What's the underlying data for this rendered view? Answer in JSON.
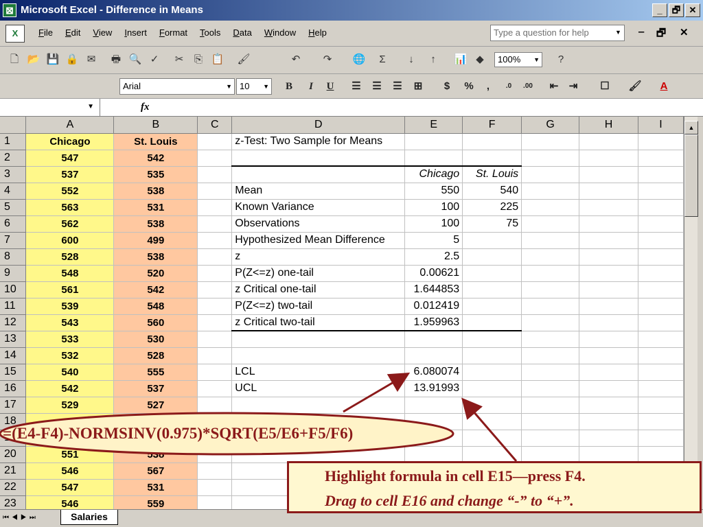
{
  "window": {
    "title": "Microsoft Excel - Difference in Means",
    "min": "_",
    "max": "🗗",
    "close": "✕"
  },
  "menu": {
    "items": [
      "File",
      "Edit",
      "View",
      "Insert",
      "Format",
      "Tools",
      "Data",
      "Window",
      "Help"
    ],
    "help_placeholder": "Type a question for help"
  },
  "toolbar": {
    "zoom": "100%",
    "font": "Arial",
    "font_size": "10"
  },
  "formula_bar": {
    "fx": "fx",
    "name_box": ""
  },
  "columns": [
    "A",
    "B",
    "C",
    "D",
    "E",
    "F",
    "G",
    "H",
    "I"
  ],
  "sheet": {
    "rows": [
      {
        "n": "1",
        "a": "Chicago",
        "b": "St. Louis",
        "d": "z-Test: Two Sample for Means",
        "e": "",
        "f": ""
      },
      {
        "n": "2",
        "a": "547",
        "b": "542",
        "d": "",
        "e": "",
        "f": ""
      },
      {
        "n": "3",
        "a": "537",
        "b": "535",
        "d": "",
        "e": "Chicago",
        "f": "St. Louis"
      },
      {
        "n": "4",
        "a": "552",
        "b": "538",
        "d": "Mean",
        "e": "550",
        "f": "540"
      },
      {
        "n": "5",
        "a": "563",
        "b": "531",
        "d": "Known Variance",
        "e": "100",
        "f": "225"
      },
      {
        "n": "6",
        "a": "562",
        "b": "538",
        "d": "Observations",
        "e": "100",
        "f": "75"
      },
      {
        "n": "7",
        "a": "600",
        "b": "499",
        "d": "Hypothesized Mean Difference",
        "e": "5",
        "f": ""
      },
      {
        "n": "8",
        "a": "528",
        "b": "538",
        "d": "z",
        "e": "2.5",
        "f": ""
      },
      {
        "n": "9",
        "a": "548",
        "b": "520",
        "d": "P(Z<=z) one-tail",
        "e": "0.00621",
        "f": ""
      },
      {
        "n": "10",
        "a": "561",
        "b": "542",
        "d": "z Critical one-tail",
        "e": "1.644853",
        "f": ""
      },
      {
        "n": "11",
        "a": "539",
        "b": "548",
        "d": "P(Z<=z) two-tail",
        "e": "0.012419",
        "f": ""
      },
      {
        "n": "12",
        "a": "543",
        "b": "560",
        "d": "z Critical two-tail",
        "e": "1.959963",
        "f": ""
      },
      {
        "n": "13",
        "a": "533",
        "b": "530",
        "d": "",
        "e": "",
        "f": ""
      },
      {
        "n": "14",
        "a": "532",
        "b": "528",
        "d": "",
        "e": "",
        "f": ""
      },
      {
        "n": "15",
        "a": "540",
        "b": "555",
        "d": "LCL",
        "e": "6.080074",
        "f": ""
      },
      {
        "n": "16",
        "a": "542",
        "b": "537",
        "d": "UCL",
        "e": "13.91993",
        "f": ""
      },
      {
        "n": "17",
        "a": "529",
        "b": "527",
        "d": "",
        "e": "",
        "f": ""
      },
      {
        "n": "18",
        "a": "",
        "b": "",
        "d": "",
        "e": "",
        "f": ""
      },
      {
        "n": "19",
        "a": "",
        "b": "",
        "d": "",
        "e": "",
        "f": ""
      },
      {
        "n": "20",
        "a": "551",
        "b": "538",
        "d": "",
        "e": "",
        "f": ""
      },
      {
        "n": "21",
        "a": "546",
        "b": "567",
        "d": "",
        "e": "",
        "f": ""
      },
      {
        "n": "22",
        "a": "547",
        "b": "531",
        "d": "",
        "e": "",
        "f": ""
      },
      {
        "n": "23",
        "a": "546",
        "b": "559",
        "d": "",
        "e": "",
        "f": ""
      }
    ],
    "tab_name": "Salaries"
  },
  "annotations": {
    "formula": "=(E4-F4)-NORMSINV(0.975)*SQRT(E5/E6+F5/F6)",
    "instruction_line1": "Highlight formula in cell E15—press F4.",
    "instruction_line2": "Drag to cell E16 and change “-” to “+”."
  },
  "colors": {
    "col_a_fill": "#fff88a",
    "col_b_fill": "#ffc8a0",
    "annotation": "#8b1a1a"
  }
}
